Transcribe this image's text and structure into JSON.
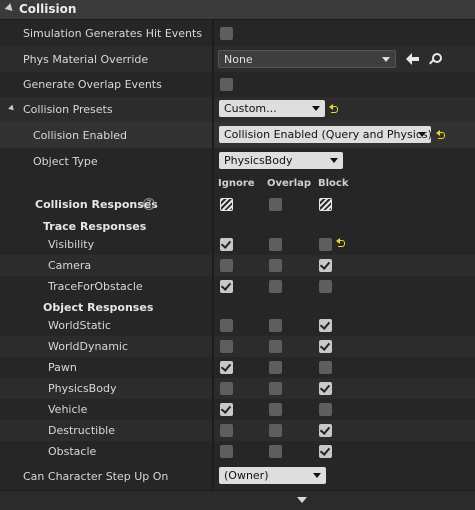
{
  "section": {
    "title": "Collision"
  },
  "props": {
    "sim_hit_events": {
      "label": "Simulation Generates Hit Events",
      "checked": false
    },
    "phys_material": {
      "label": "Phys Material Override",
      "value": "None"
    },
    "overlap_events": {
      "label": "Generate Overlap Events",
      "checked": false
    },
    "presets": {
      "label": "Collision Presets",
      "value": "Custom..."
    },
    "collision_enabled": {
      "label": "Collision Enabled",
      "value": "Collision Enabled (Query and Physics)"
    },
    "object_type": {
      "label": "Object Type",
      "value": "PhysicsBody"
    },
    "step_up": {
      "label": "Can Character Step Up On",
      "value": "(Owner)"
    }
  },
  "columns": {
    "ignore": "Ignore",
    "overlap": "Overlap",
    "block": "Block"
  },
  "collision_responses": {
    "label": "Collision Responses",
    "help": "?"
  },
  "trace_responses": {
    "label": "Trace Responses",
    "rows": [
      {
        "name": "Visibility",
        "ignore": true,
        "overlap": false,
        "block": false,
        "reset": true
      },
      {
        "name": "Camera",
        "ignore": false,
        "overlap": false,
        "block": true,
        "reset": false
      },
      {
        "name": "TraceForObstacle",
        "ignore": true,
        "overlap": false,
        "block": false,
        "reset": false
      }
    ]
  },
  "object_responses": {
    "label": "Object Responses",
    "rows": [
      {
        "name": "WorldStatic",
        "ignore": false,
        "overlap": false,
        "block": true
      },
      {
        "name": "WorldDynamic",
        "ignore": false,
        "overlap": false,
        "block": true
      },
      {
        "name": "Pawn",
        "ignore": true,
        "overlap": false,
        "block": false
      },
      {
        "name": "PhysicsBody",
        "ignore": false,
        "overlap": false,
        "block": true
      },
      {
        "name": "Vehicle",
        "ignore": true,
        "overlap": false,
        "block": false
      },
      {
        "name": "Destructible",
        "ignore": false,
        "overlap": false,
        "block": true
      },
      {
        "name": "Obstacle",
        "ignore": false,
        "overlap": false,
        "block": true
      }
    ]
  }
}
